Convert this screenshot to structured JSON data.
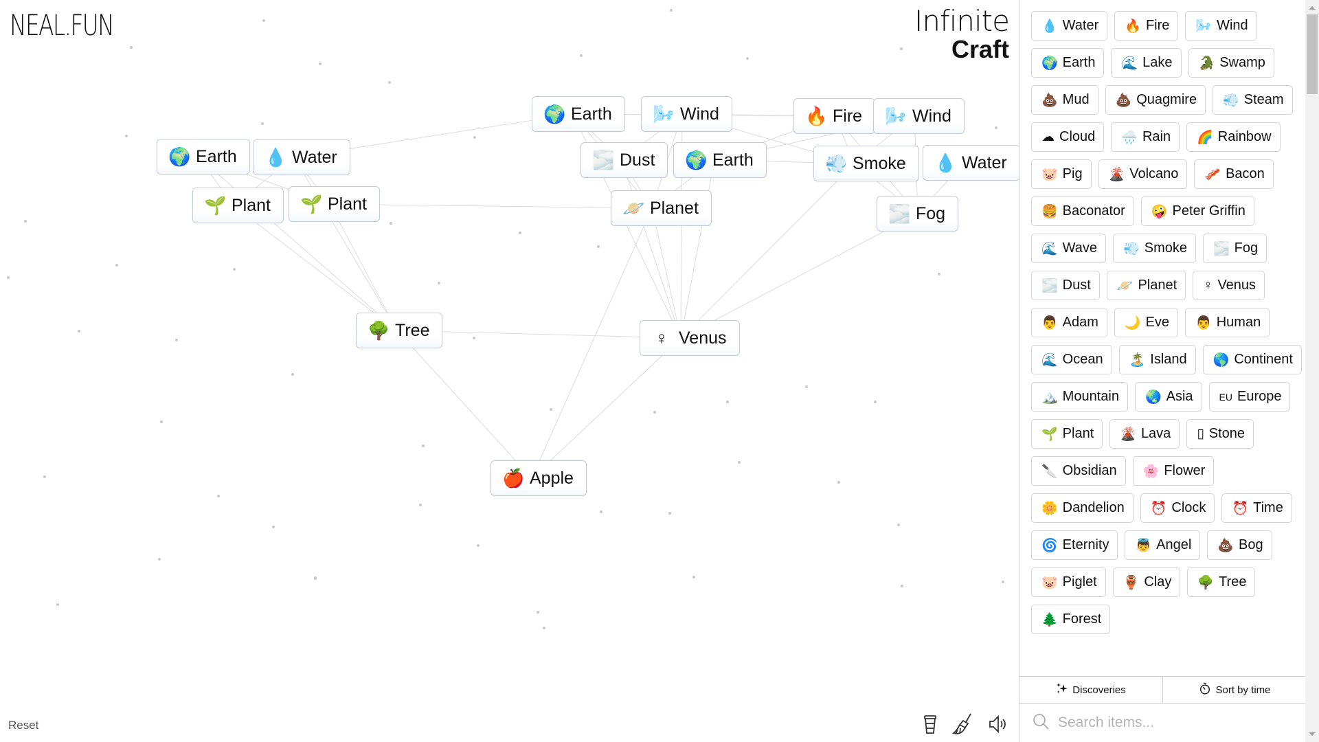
{
  "header": {
    "logo": "NEAL.FUN",
    "title_line1": "Infinite",
    "title_line2": "Craft"
  },
  "canvas": {
    "nodes": [
      {
        "id": "n1",
        "emoji": "🌍",
        "label": "Earth"
      },
      {
        "id": "n2",
        "emoji": "💧",
        "label": "Water"
      },
      {
        "id": "n3",
        "emoji": "🌱",
        "label": "Plant"
      },
      {
        "id": "n4",
        "emoji": "🌱",
        "label": "Plant"
      },
      {
        "id": "n5",
        "emoji": "🌍",
        "label": "Earth"
      },
      {
        "id": "n6",
        "emoji": "🌬️",
        "label": "Wind"
      },
      {
        "id": "n7",
        "emoji": "🔥",
        "label": "Fire"
      },
      {
        "id": "n8",
        "emoji": "🌬️",
        "label": "Wind"
      },
      {
        "id": "n9",
        "emoji": "🌫️",
        "label": "Dust"
      },
      {
        "id": "n10",
        "emoji": "🌍",
        "label": "Earth"
      },
      {
        "id": "n11",
        "emoji": "💨",
        "label": "Smoke"
      },
      {
        "id": "n12",
        "emoji": "💧",
        "label": "Water"
      },
      {
        "id": "n13",
        "emoji": "🪐",
        "label": "Planet"
      },
      {
        "id": "n14",
        "emoji": "🌫️",
        "label": "Fog"
      },
      {
        "id": "n15",
        "emoji": "🌳",
        "label": "Tree"
      },
      {
        "id": "n16",
        "emoji": "♀",
        "label": "Venus"
      },
      {
        "id": "n17",
        "emoji": "🍎",
        "label": "Apple"
      }
    ],
    "reset_label": "Reset",
    "tools": [
      {
        "name": "coffee-cup-icon"
      },
      {
        "name": "broom-icon"
      },
      {
        "name": "speaker-icon"
      }
    ]
  },
  "sidebar": {
    "items": [
      {
        "emoji": "💧",
        "label": "Water"
      },
      {
        "emoji": "🔥",
        "label": "Fire"
      },
      {
        "emoji": "🌬️",
        "label": "Wind"
      },
      {
        "emoji": "🌍",
        "label": "Earth"
      },
      {
        "emoji": "🌊",
        "label": "Lake"
      },
      {
        "emoji": "🐊",
        "label": "Swamp"
      },
      {
        "emoji": "💩",
        "label": "Mud"
      },
      {
        "emoji": "💩",
        "label": "Quagmire"
      },
      {
        "emoji": "💨",
        "label": "Steam"
      },
      {
        "emoji": "☁",
        "label": "Cloud"
      },
      {
        "emoji": "🌧️",
        "label": "Rain"
      },
      {
        "emoji": "🌈",
        "label": "Rainbow"
      },
      {
        "emoji": "🐷",
        "label": "Pig"
      },
      {
        "emoji": "🌋",
        "label": "Volcano"
      },
      {
        "emoji": "🥓",
        "label": "Bacon"
      },
      {
        "emoji": "🍔",
        "label": "Baconator"
      },
      {
        "emoji": "🤪",
        "label": "Peter Griffin"
      },
      {
        "emoji": "🌊",
        "label": "Wave"
      },
      {
        "emoji": "💨",
        "label": "Smoke"
      },
      {
        "emoji": "🌫️",
        "label": "Fog"
      },
      {
        "emoji": "🌫️",
        "label": "Dust"
      },
      {
        "emoji": "🪐",
        "label": "Planet"
      },
      {
        "emoji": "♀",
        "label": "Venus"
      },
      {
        "emoji": "👨",
        "label": "Adam"
      },
      {
        "emoji": "🌙",
        "label": "Eve"
      },
      {
        "emoji": "👨",
        "label": "Human"
      },
      {
        "emoji": "🌊",
        "label": "Ocean"
      },
      {
        "emoji": "🏝️",
        "label": "Island"
      },
      {
        "emoji": "🌎",
        "label": "Continent"
      },
      {
        "emoji": "🏔️",
        "label": "Mountain"
      },
      {
        "emoji": "🌏",
        "label": "Asia"
      },
      {
        "emoji": "EU",
        "label": "Europe"
      },
      {
        "emoji": "🌱",
        "label": "Plant"
      },
      {
        "emoji": "🌋",
        "label": "Lava"
      },
      {
        "emoji": "▯",
        "label": "Stone"
      },
      {
        "emoji": "🔪",
        "label": "Obsidian"
      },
      {
        "emoji": "🌸",
        "label": "Flower"
      },
      {
        "emoji": "🌼",
        "label": "Dandelion"
      },
      {
        "emoji": "⏰",
        "label": "Clock"
      },
      {
        "emoji": "⏰",
        "label": "Time"
      },
      {
        "emoji": "🌀",
        "label": "Eternity"
      },
      {
        "emoji": "👼",
        "label": "Angel"
      },
      {
        "emoji": "💩",
        "label": "Bog"
      },
      {
        "emoji": "🐷",
        "label": "Piglet"
      },
      {
        "emoji": "🏺",
        "label": "Clay"
      },
      {
        "emoji": "🌳",
        "label": "Tree"
      },
      {
        "emoji": "🌲",
        "label": "Forest"
      }
    ],
    "discoveries_label": "Discoveries",
    "sort_label": "Sort by time",
    "search_placeholder": "Search items...",
    "search_value": ""
  }
}
